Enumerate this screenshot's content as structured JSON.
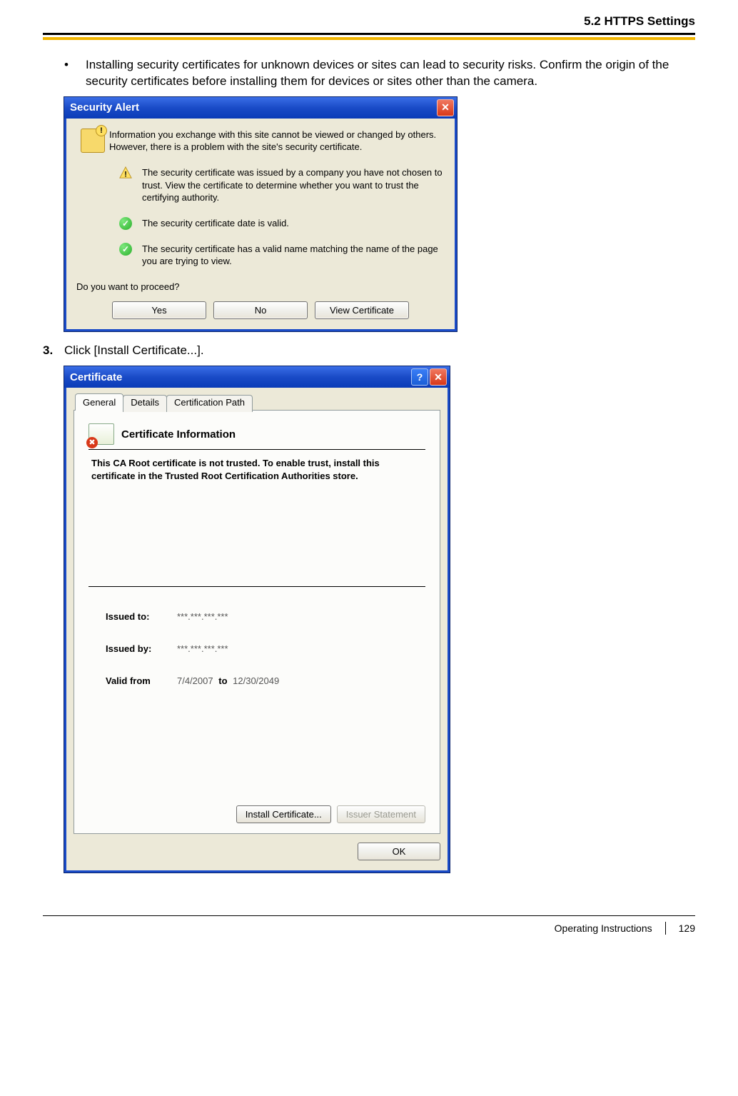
{
  "header": {
    "section_title": "5.2 HTTPS Settings"
  },
  "bullet": {
    "text": "Installing security certificates for unknown devices or sites can lead to security risks. Confirm the origin of the security certificates before installing them for devices or sites other than the camera."
  },
  "security_alert": {
    "title": "Security Alert",
    "intro": "Information you exchange with this site cannot be viewed or changed by others. However, there is a problem with the site's security certificate.",
    "items": [
      {
        "status": "warn",
        "text": "The security certificate was issued by a company you have not chosen to trust. View the certificate to determine whether you want to trust the certifying authority."
      },
      {
        "status": "ok",
        "text": "The security certificate date is valid."
      },
      {
        "status": "ok",
        "text": "The security certificate has a valid name matching the name of the page you are trying to view."
      }
    ],
    "proceed_prompt": "Do you want to proceed?",
    "buttons": {
      "yes": "Yes",
      "no": "No",
      "view": "View Certificate"
    }
  },
  "step3": {
    "number": "3.",
    "text": "Click [Install Certificate...]."
  },
  "certificate": {
    "title": "Certificate",
    "tabs": {
      "general": "General",
      "details": "Details",
      "path": "Certification Path"
    },
    "heading": "Certificate Information",
    "trust_msg": "This CA Root certificate is not trusted. To enable trust, install this certificate in the Trusted Root Certification Authorities store.",
    "issued_to_label": "Issued to:",
    "issued_to_value": "***.***.***.***",
    "issued_by_label": "Issued by:",
    "issued_by_value": "***.***.***.***",
    "valid_from_label": "Valid from",
    "valid_from_value": "7/4/2007",
    "valid_to_label": "to",
    "valid_to_value": "12/30/2049",
    "buttons": {
      "install": "Install Certificate...",
      "issuer": "Issuer Statement",
      "ok": "OK"
    }
  },
  "footer": {
    "doc": "Operating Instructions",
    "page": "129"
  }
}
